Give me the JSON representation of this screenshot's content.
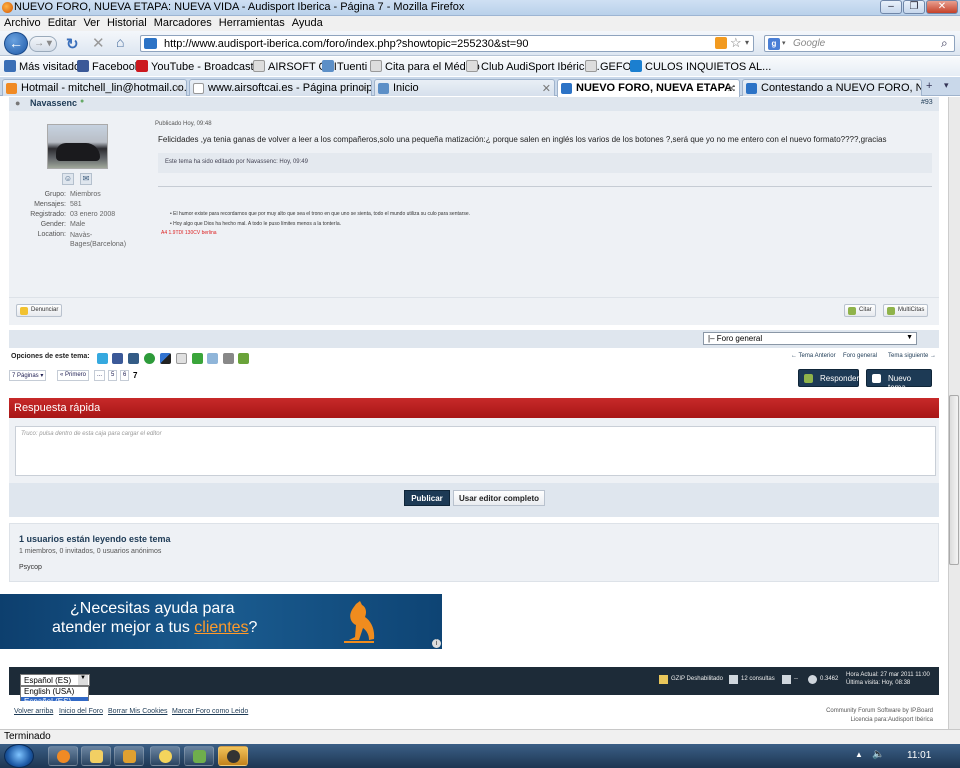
{
  "window": {
    "title": "NUEVO FORO, NUEVA ETAPA: NUEVA VIDA - Audisport Iberica - Página 7 - Mozilla Firefox"
  },
  "menu": [
    "Archivo",
    "Editar",
    "Ver",
    "Historial",
    "Marcadores",
    "Herramientas",
    "Ayuda"
  ],
  "nav": {
    "url": "http://www.audisport-iberica.com/foro/index.php?showtopic=255230&st=90",
    "search_placeholder": "Google"
  },
  "bookmarks": [
    {
      "label": "Más visitados",
      "color": "#3b6fb6"
    },
    {
      "label": "Facebook",
      "color": "#3b5998"
    },
    {
      "label": "YouTube - Broadcast ...",
      "color": "#cc181e"
    },
    {
      "label": "AIRSOFT CAI",
      "color": "#dddddd"
    },
    {
      "label": "Tuenti",
      "color": "#5c8fc7"
    },
    {
      "label": "Cita para el Médico",
      "color": "#dddddd"
    },
    {
      "label": "Club AudiSport Ibérica...",
      "color": "#dddddd"
    },
    {
      "label": "GEFOC",
      "color": "#dddddd"
    },
    {
      "label": "CULOS INQUIETOS AL...",
      "color": "#1b7fd0"
    }
  ],
  "tabs": [
    {
      "label": "Hotmail - mitchell_lin@hotmail.co...",
      "active": false
    },
    {
      "label": "www.airsoftcai.es - Página principal",
      "active": false
    },
    {
      "label": "Inicio",
      "active": false
    },
    {
      "label": "NUEVO FORO, NUEVA ETAPA: N...",
      "active": true
    },
    {
      "label": "Contestando a NUEVO FORO, NUE...",
      "active": false
    }
  ],
  "post": {
    "author": "Navassenc",
    "number": "#93",
    "published": "Publicado Hoy, 09:48",
    "body": "Felicidades ,ya tenia ganas de volver a leer a los compañeros,solo una pequeña matización:¿ porque salen en inglés los varios de los botones ?,será que yo no me entero con el nuevo formato????,gracias",
    "edited": "Este tema ha sido editado por Navassenc: Hoy, 09:49",
    "profile": [
      {
        "label": "Grupo:",
        "value": "Miembros"
      },
      {
        "label": "Mensajes:",
        "value": "581"
      },
      {
        "label": "Registrado:",
        "value": "03 enero 2008"
      },
      {
        "label": "Gender:",
        "value": "Male"
      },
      {
        "label": "Location:",
        "value": "Navàs-Bages(Barcelona)"
      }
    ],
    "signature": [
      "El humor existe para recordarnos que por muy alto que sea el trono en que uno se sienta, todo el mundo utiliza su culo para sentarse.",
      "Hoy algo que Dios ha hecho mal. A todo le puso límites menos a la tontería."
    ],
    "car": "A4 1.9TDI 130CV berlina",
    "report": "Denunciar",
    "quote": "Citar",
    "multiquote": "MultiCitas"
  },
  "forum_select": "|– Foro general",
  "share_label": "Opciones de este tema:",
  "share_icons": [
    {
      "name": "twitter",
      "color": "#35a9df"
    },
    {
      "name": "facebook",
      "color": "#3b5998"
    },
    {
      "name": "digg",
      "color": "#345c86"
    },
    {
      "name": "msn",
      "color": "#2d9b3a"
    },
    {
      "name": "delicious",
      "color": "#3274d1"
    },
    {
      "name": "stumble",
      "color": "#e0e0e0"
    },
    {
      "name": "print-friendly",
      "color": "#3aa53a"
    },
    {
      "name": "email",
      "color": "#8fb5d9"
    },
    {
      "name": "print",
      "color": "#888888"
    },
    {
      "name": "download",
      "color": "#6aa33a"
    }
  ],
  "topic_nav": {
    "prev": "← Tema Anterior",
    "forum": "Foro general",
    "next": "Tema siguiente →"
  },
  "pagination": {
    "pages": "7 Páginas",
    "first": "« Primero",
    "ellipsis": "...",
    "p5": "5",
    "p6": "6",
    "current": "7"
  },
  "buttons": {
    "reply": "Responder",
    "new_topic": "Nuevo tema"
  },
  "quick_reply": {
    "title": "Respuesta rápida",
    "placeholder": "Truco: pulsa dentro de esta caja para cargar el editor",
    "publish": "Publicar",
    "full_editor": "Usar editor completo"
  },
  "readers": {
    "title": "1 usuarios están leyendo este tema",
    "detail": "1 miembros, 0 invitados, 0 usuarios anónimos",
    "user": "Psycop"
  },
  "ad": {
    "line1": "¿Necesitas ayuda para",
    "line2a": "atender mejor a tus ",
    "line2b": "clientes",
    "line2c": "?"
  },
  "footer": {
    "lang_selected": "Español (ES)",
    "lang_options": [
      "English (USA)",
      "Español (ES)"
    ],
    "gzip": "GZIP Deshabilitado",
    "queries": "12 consultas",
    "dash": "--",
    "load": "0.3462",
    "time1": "Hora Actual: 27 mar 2011 11:00",
    "time2": "Última visita: Hoy, 08:38",
    "links": [
      "Volver arriba",
      "Inicio del Foro",
      "Borrar Mis Cookies",
      "Marcar Foro como Leido"
    ],
    "credit1": "Community Forum Software by IP.Board",
    "credit2": "Licencia para:Audisport Ibérica"
  },
  "status": "Terminado",
  "clock": "11:01"
}
